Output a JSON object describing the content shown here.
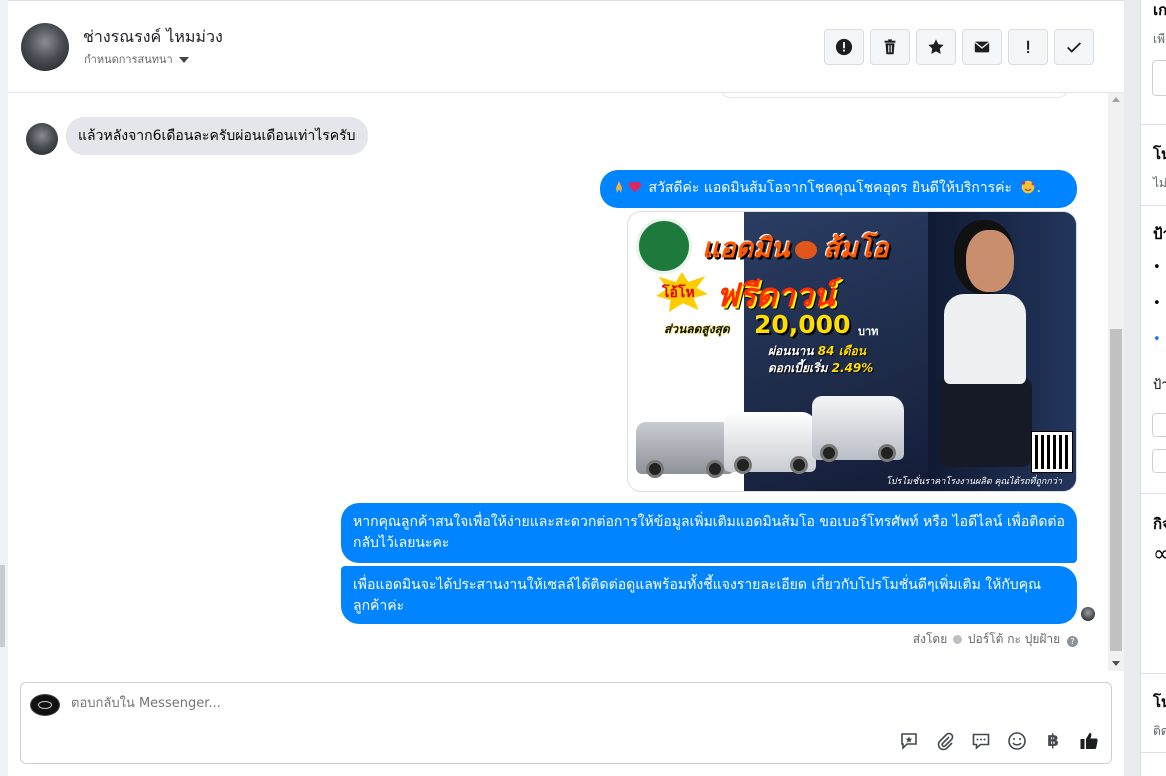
{
  "header": {
    "contact_name": "ช่างรณรงค์ ไหมม่วง",
    "assign_label": "กำหนดการสนทนา",
    "actions": [
      {
        "name": "report-spam-button",
        "icon": "exclamation-circle-icon"
      },
      {
        "name": "delete-button",
        "icon": "trash-icon"
      },
      {
        "name": "star-button",
        "icon": "star-icon"
      },
      {
        "name": "mark-unread-button",
        "icon": "envelope-icon"
      },
      {
        "name": "mark-important-button",
        "icon": "exclamation-icon"
      },
      {
        "name": "mark-done-button",
        "icon": "check-icon"
      }
    ]
  },
  "conversation": {
    "incoming_message": "แล้วหลังจาก6เดือนละครับผ่อนเดือนเท่าไรครับ",
    "outgoing_greeting": "สวัสดีค่ะ แอดมินส้มโอจากโชคคุณโชคอุดร ยินดีให้บริการค่ะ",
    "outgoing_greeting_suffix": ".",
    "promo_image": {
      "title_left": "แอดมิน",
      "title_right": "ส้มโอ",
      "burst": "โอ้โห",
      "free_down": "ฟรีดาวน์",
      "discount_label": "ส่วนลดสูงสุด",
      "discount_amount": "20,000",
      "currency": "บาท",
      "term_label": "ผ่อนนาน",
      "term_value": "84 เดือน",
      "rate_label": "ดอกเบี้ยเริ่ม",
      "rate_value": "2.49%",
      "footer": "โปรโมชั่นราคาโรงงานผลิต คุณได้รถที่ถูกกว่า"
    },
    "outgoing_message_2": "หากคุณลูกค้าสนใจเพื่อให้ง่ายและสะดวกต่อการให้ข้อมูลเพิ่มเติมแอดมินส้มโอ ขอเบอร์โทรศัพท์ หรือ ไอดีไลน์ เพื่อติดต่อกลับไว้เลยนะคะ",
    "outgoing_message_3": "เพื่อแอดมินจะได้ประสานงานให้เซลล์ได้ติดต่อดูแลพร้อมทั้งชี้แจงรายละเอียด เกี่ยวกับโปรโมชั่นดีๆเพิ่มเติม ให้กับคุณลูกค้าค่ะ",
    "sent_by_label": "ส่งโดย",
    "sent_by_name": "ปอร์โต้ กะ ปุยฝ้าย"
  },
  "composer": {
    "placeholder": "ตอบกลับใน Messenger...",
    "tools": [
      "saved-reply-icon",
      "attachment-icon",
      "speech-bubble-icon",
      "emoji-icon",
      "baht-icon",
      "thumbs-up-icon"
    ],
    "baht_symbol": "฿"
  },
  "right_panel": {
    "texts": [
      "เก",
      "เพื",
      "โน",
      "ไม่",
      "ป้า",
      "ป้า",
      "กิจ",
      "∝",
      "โน",
      "ติด"
    ]
  },
  "colors": {
    "accent": "#0084ff",
    "incoming_bubble": "#e4e6eb"
  }
}
